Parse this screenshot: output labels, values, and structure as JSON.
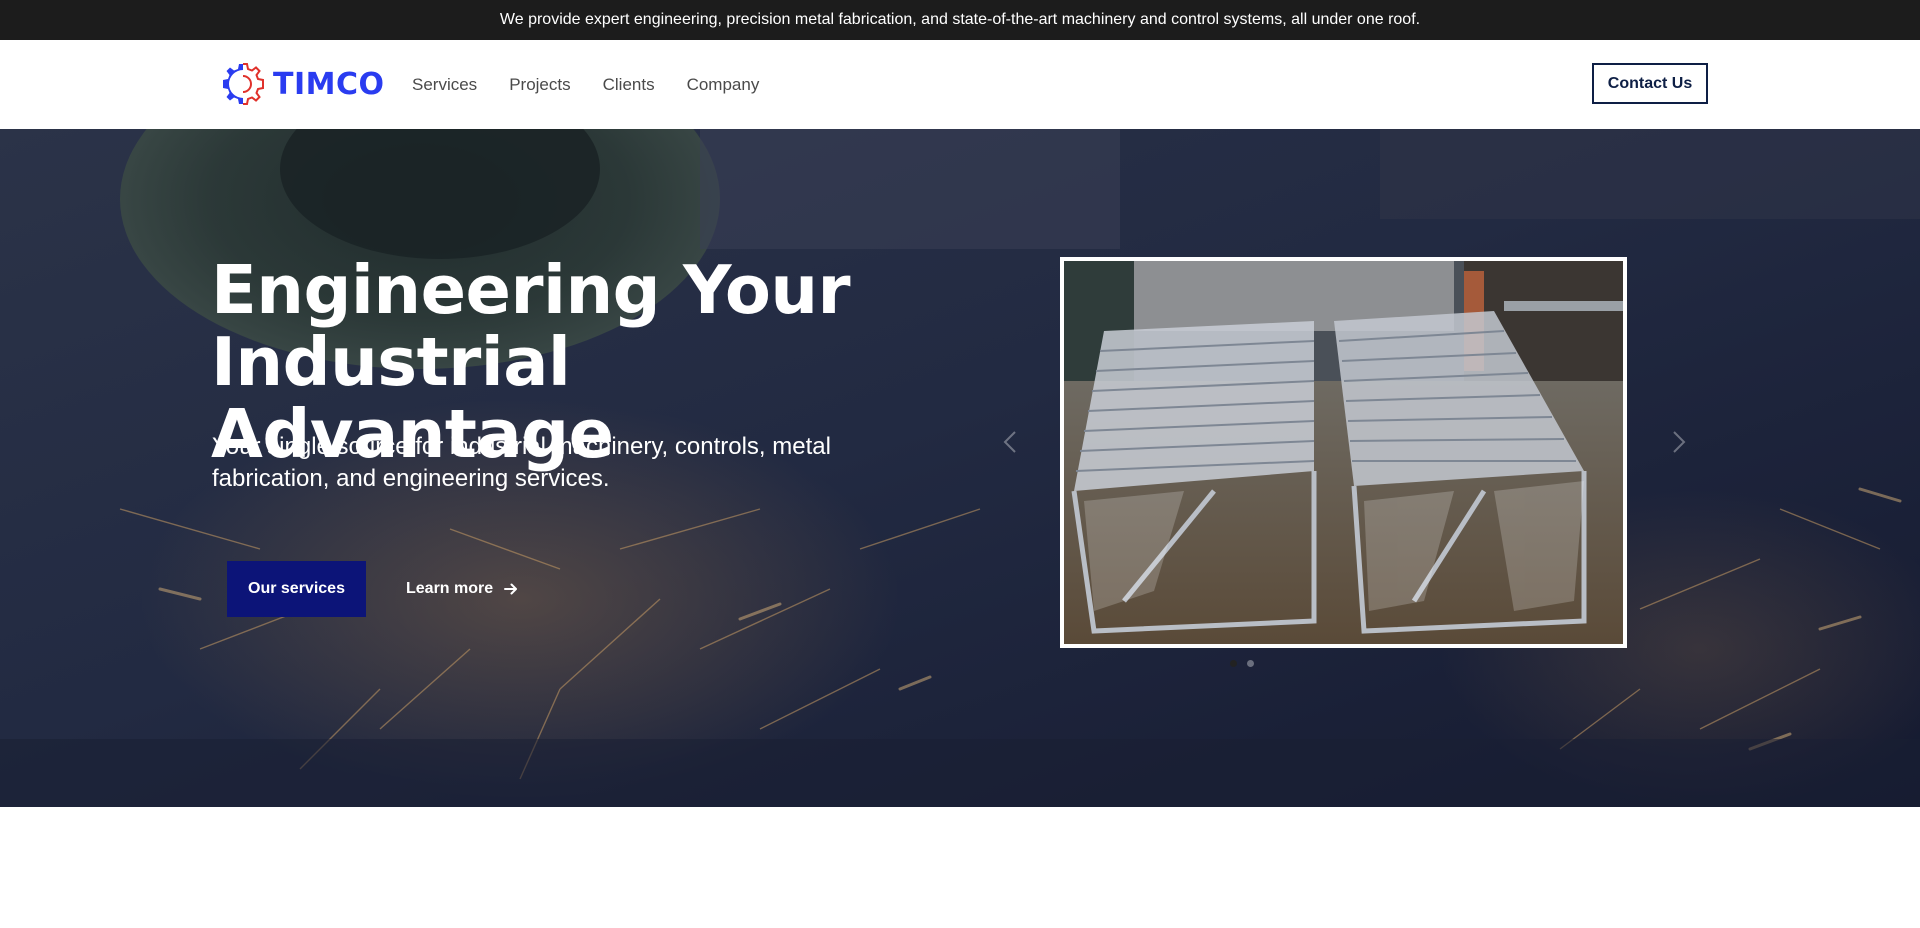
{
  "announcement": {
    "text": "We provide expert engineering, precision metal fabrication, and state-of-the-art machinery and control systems, all under one roof."
  },
  "header": {
    "logo_text": "TIMCO",
    "logo_icon": "gear-icon",
    "nav": [
      {
        "label": "Services"
      },
      {
        "label": "Projects"
      },
      {
        "label": "Clients"
      },
      {
        "label": "Company"
      }
    ],
    "contact_label": "Contact Us"
  },
  "hero": {
    "title_line1": "Engineering Your",
    "title_line2": "Industrial Advantage",
    "subtitle": "Your single source for industrial machinery, controls, metal fabrication, and engineering services.",
    "primary_button": "Our services",
    "secondary_link": "Learn more",
    "carousel": {
      "image_subject": "roller conveyors wrapped in plastic",
      "slide_count": 2,
      "active_slide": 1
    }
  },
  "colors": {
    "brand_blue": "#2a3cf0",
    "brand_red": "#e0312b",
    "primary_button": "#0c1478",
    "announcement_bg": "#1c1c1c",
    "contact_border": "#0e1f45"
  }
}
